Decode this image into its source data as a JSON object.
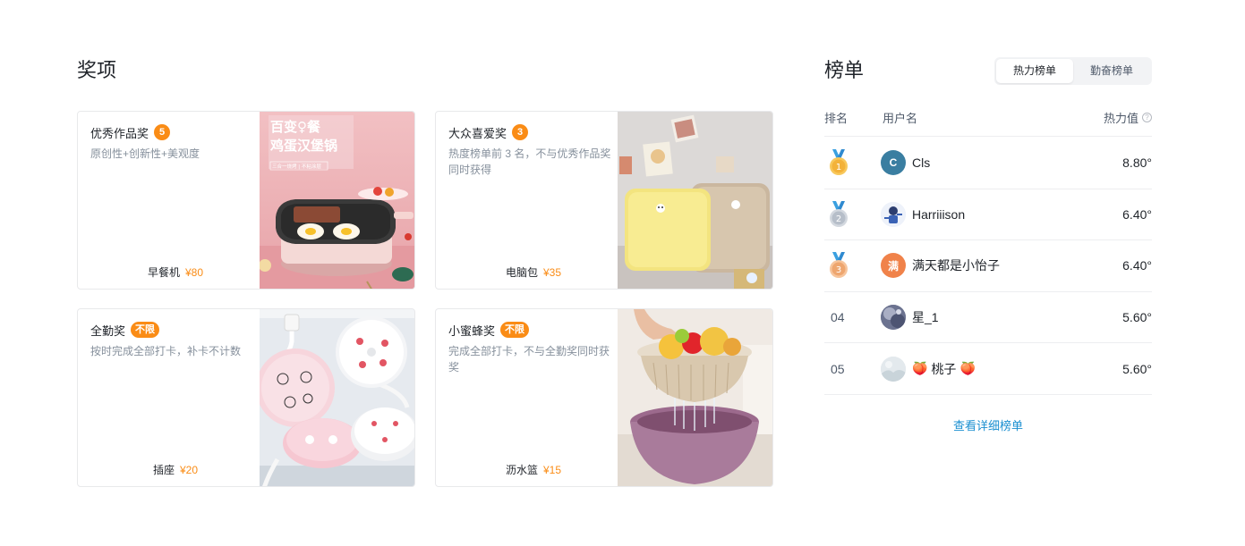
{
  "awards": {
    "title": "奖项",
    "items": [
      {
        "name": "优秀作品奖",
        "badge": "5",
        "desc": "原创性+创新性+美观度",
        "prize_name": "早餐机",
        "prize_price": "¥80",
        "image": "breakfast-machine"
      },
      {
        "name": "大众喜爱奖",
        "badge": "3",
        "desc": "热度榜单前 3 名，不与优秀作品奖同时获得",
        "prize_name": "电脑包",
        "prize_price": "¥35",
        "image": "laptop-bag"
      },
      {
        "name": "全勤奖",
        "badge": "不限",
        "desc": "按时完成全部打卡，补卡不计数",
        "prize_name": "插座",
        "prize_price": "¥20",
        "image": "power-socket"
      },
      {
        "name": "小蜜蜂奖",
        "badge": "不限",
        "desc": "完成全部打卡，不与全勤奖同时获奖",
        "prize_name": "沥水篮",
        "prize_price": "¥15",
        "image": "drain-basket"
      }
    ],
    "images": {
      "breakfast": {
        "line1": "百变♀餐",
        "line2": "鸡蛋汉堡锅",
        "line3": "三合一烧烤 | 不粘涂层"
      }
    }
  },
  "board": {
    "title": "榜单",
    "tabs": [
      {
        "label": "热力榜单",
        "active": true
      },
      {
        "label": "勤奋榜单",
        "active": false
      }
    ],
    "columns": {
      "rank": "排名",
      "user": "用户名",
      "heat": "热力值"
    },
    "help_icon": "question-circle-icon",
    "rows": [
      {
        "rank": "1",
        "medal": "gold-medal-icon",
        "avatar_text": "C",
        "avatar_color": "#3a7ea1",
        "name": "Cls",
        "heat": "8.80°"
      },
      {
        "rank": "2",
        "medal": "silver-medal-icon",
        "avatar_text": "",
        "avatar_color": "#e8eef8",
        "name": "Harriiison",
        "heat": "6.40°"
      },
      {
        "rank": "3",
        "medal": "bronze-medal-icon",
        "avatar_text": "满",
        "avatar_color": "#f0824a",
        "name": "满天都是小怡子",
        "heat": "6.40°"
      },
      {
        "rank": "04",
        "medal": "",
        "avatar_text": "",
        "avatar_color": "#8c93a8",
        "name": "星_1",
        "heat": "5.60°"
      },
      {
        "rank": "05",
        "medal": "",
        "avatar_text": "",
        "avatar_color": "#dfe6ea",
        "name": "桃子",
        "name_prefix": "🍑",
        "name_suffix": "🍑",
        "heat": "5.60°"
      }
    ],
    "more_link": "查看详细榜单"
  }
}
